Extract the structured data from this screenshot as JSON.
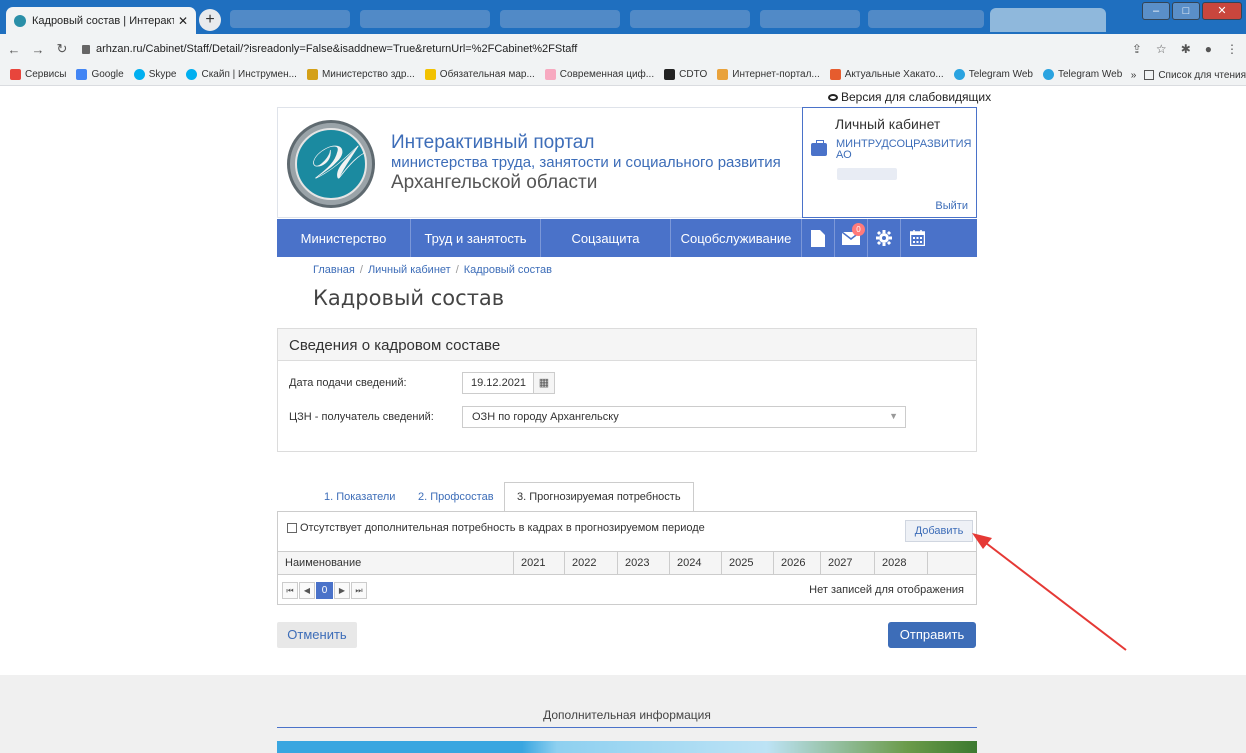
{
  "browser": {
    "active_tab_title": "Кадровый состав | Интерактив",
    "tab_close": "✕",
    "new_tab": "+",
    "url": "arhzan.ru/Cabinet/Staff/Detail/?isreadonly=False&isaddnew=True&returnUrl=%2FCabinet%2FStaff",
    "bookmarks": [
      "Сервисы",
      "Google",
      "Skype",
      "Скайп | Инструмен...",
      "Министерство здр...",
      "Обязательная мар...",
      "Современная циф...",
      "CDTO",
      "Интернет-портал...",
      "Актуальные Хакато...",
      "Telegram Web",
      "Telegram Web"
    ],
    "bookmark_overflow": "»",
    "reading_list": "Список для чтения"
  },
  "accessibility_link": "Версия для слабовидящих",
  "header": {
    "title_line1": "Интерактивный портал",
    "title_line2": "министерства труда, занятости и социального развития",
    "title_line3": "Архангельской области"
  },
  "cabinet": {
    "title": "Личный кабинет",
    "org": "МИНТРУДСОЦРАЗВИТИЯ АО",
    "logout": "Выйти"
  },
  "nav": {
    "items": [
      "Министерство",
      "Труд и занятость",
      "Соцзащита",
      "Соцобслуживание"
    ],
    "mail_badge": "0"
  },
  "breadcrumb": [
    "Главная",
    "Личный кабинет",
    "Кадровый состав"
  ],
  "page_title": "Кадровый состав",
  "panel": {
    "heading": "Сведения о кадровом составе",
    "date_label": "Дата подачи сведений:",
    "date_value": "19.12.2021",
    "czn_label": "ЦЗН - получатель сведений:",
    "czn_value": "ОЗН по городу Архангельску"
  },
  "tabs": [
    "1. Показатели",
    "2. Профсостав",
    "3. Прогнозируемая потребность"
  ],
  "grid": {
    "checkbox_label": "Отсутствует дополнительная потребность в кадрах в прогнозируемом периоде",
    "add_button": "Добавить",
    "columns": [
      "Наименование",
      "2021",
      "2022",
      "2023",
      "2024",
      "2025",
      "2026",
      "2027",
      "2028"
    ],
    "current_page": "0",
    "no_records": "Нет записей для отображения"
  },
  "actions": {
    "cancel": "Отменить",
    "submit": "Отправить"
  },
  "footer": {
    "title": "Дополнительная информация"
  }
}
